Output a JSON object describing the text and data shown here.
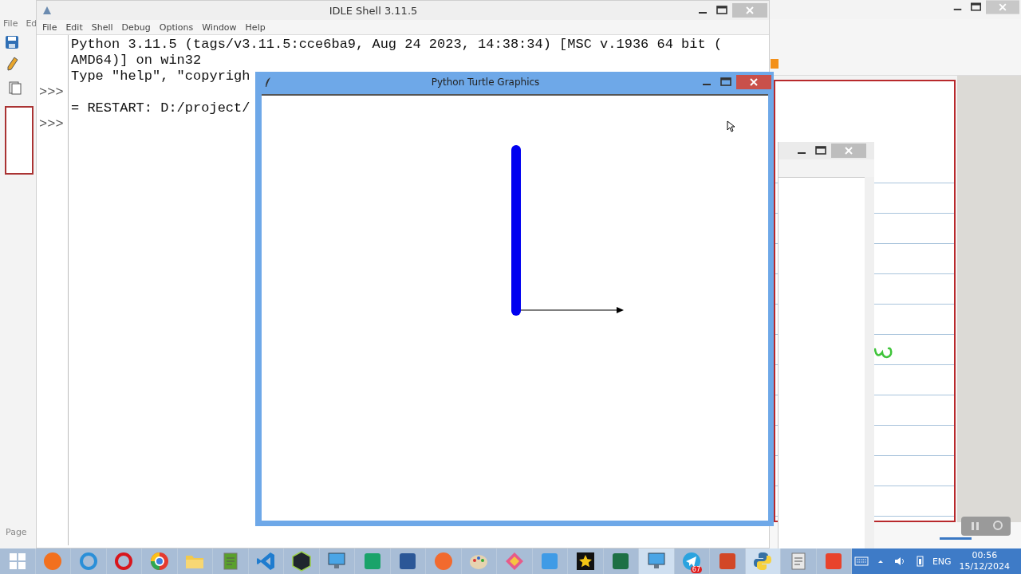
{
  "background_app": {
    "menu": [
      "File",
      "Ed"
    ],
    "status_label": "Page"
  },
  "idle_window": {
    "title": "IDLE Shell 3.11.5",
    "menu": [
      "File",
      "Edit",
      "Shell",
      "Debug",
      "Options",
      "Window",
      "Help"
    ],
    "lines": [
      {
        "text": "Python 3.11.5 (tags/v3.11.5:cce6ba9, Aug 24 2023, 14:38:34) [MSC v.1936 64 bit ("
      },
      {
        "text": "AMD64)] on win32"
      },
      {
        "text": "Type \"help\", \"copyrigh"
      },
      {
        "prompt": ">>>"
      },
      {
        "text": "= RESTART: D:/project/"
      },
      {
        "prompt": ">>>"
      }
    ]
  },
  "turtle_window": {
    "title": "Python Turtle Graphics"
  },
  "taskbar": {
    "apps": [
      {
        "kind": "start",
        "selected": false
      },
      {
        "kind": "circle",
        "selected": false,
        "color": "#f2701e"
      },
      {
        "kind": "ring",
        "selected": false,
        "color": "#2a8fd8"
      },
      {
        "kind": "ring",
        "selected": false,
        "color": "#d8151c"
      },
      {
        "kind": "wheel",
        "selected": false
      },
      {
        "kind": "folder",
        "selected": false
      },
      {
        "kind": "document",
        "selected": false,
        "color": "#5aa02c"
      },
      {
        "kind": "ribbon",
        "selected": false,
        "color": "#1f7ccf"
      },
      {
        "kind": "hexagon",
        "selected": false,
        "color": "#20262e"
      },
      {
        "kind": "monitor",
        "selected": false
      },
      {
        "kind": "tile",
        "selected": false,
        "color": "#1aa36a"
      },
      {
        "kind": "tile",
        "selected": false,
        "color": "#2b5797"
      },
      {
        "kind": "circle",
        "selected": false,
        "color": "#f26a2e"
      },
      {
        "kind": "palette",
        "selected": false
      },
      {
        "kind": "diamond",
        "selected": false
      },
      {
        "kind": "tile",
        "selected": false,
        "color": "#3f9be6"
      },
      {
        "kind": "star",
        "selected": false
      },
      {
        "kind": "tile",
        "selected": false,
        "color": "#1d7044"
      },
      {
        "kind": "monitor",
        "selected": true
      },
      {
        "kind": "plane",
        "selected": false,
        "badge": "67"
      },
      {
        "kind": "tile",
        "selected": false,
        "color": "#d24726"
      },
      {
        "kind": "snake",
        "selected": true
      },
      {
        "kind": "document",
        "selected": false,
        "color": "#e8e8e8"
      },
      {
        "kind": "tile",
        "selected": false,
        "color": "#e8432c"
      }
    ],
    "language": "ENG",
    "time": "00:56",
    "date": "15/12/2024"
  }
}
